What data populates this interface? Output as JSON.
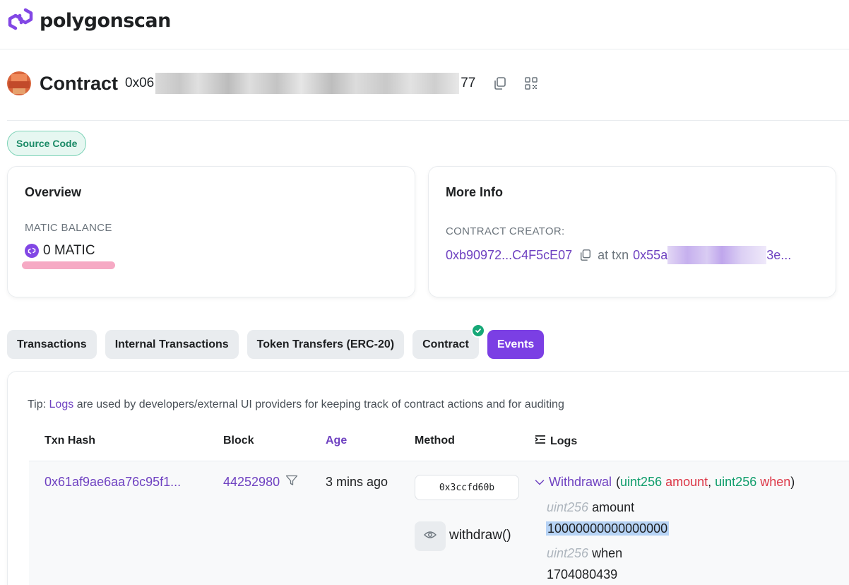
{
  "header": {
    "brand": "polygonscan",
    "logo_icon": "polygon-logo-icon"
  },
  "contract": {
    "label": "Contract",
    "address_prefix": "0x06",
    "address_suffix": "77"
  },
  "badge": {
    "source_code": "Source Code"
  },
  "overview": {
    "title": "Overview",
    "balance_label": "MATIC BALANCE",
    "balance_value": "0 MATIC"
  },
  "more_info": {
    "title": "More Info",
    "creator_label": "CONTRACT CREATOR:",
    "creator_address": "0xb90972...C4F5cE07",
    "at_txn_label": "at txn",
    "txn_prefix": "0x55a",
    "txn_suffix": "3e..."
  },
  "tabs": [
    {
      "label": "Transactions",
      "active": false
    },
    {
      "label": "Internal Transactions",
      "active": false
    },
    {
      "label": "Token Transfers (ERC-20)",
      "active": false
    },
    {
      "label": "Contract",
      "active": false,
      "verified": true
    },
    {
      "label": "Events",
      "active": true
    }
  ],
  "events": {
    "tip_prefix": "Tip:",
    "tip_link": "Logs",
    "tip_text": "are used by developers/external UI providers for keeping track of contract actions and for auditing",
    "columns": {
      "txn_hash": "Txn Hash",
      "block": "Block",
      "age": "Age",
      "method": "Method",
      "logs": "Logs"
    },
    "row": {
      "txn_hash": "0x61af9ae6aa76c95f1...",
      "block": "44252980",
      "age": "3 mins ago",
      "method_id": "0x3ccfd60b",
      "method_name": "withdraw()",
      "event_name": "Withdrawal",
      "param_type_1": "uint256",
      "param_name_1": "amount",
      "param_type_2": "uint256",
      "param_name_2": "when",
      "open_paren": "(",
      "comma": ",",
      "close_paren": ")",
      "arg1_type": "uint256",
      "arg1_name": "amount",
      "arg1_value": "10000000000000000",
      "arg2_type": "uint256",
      "arg2_name": "when",
      "arg2_value": "1704080439"
    }
  },
  "colors": {
    "brand_purple": "#8247e5",
    "link_purple": "#6f42c1",
    "active_tab": "#7b3fe4",
    "verified_green": "#16a877",
    "type_green": "#0f9d6b",
    "param_red": "#dc3545"
  }
}
